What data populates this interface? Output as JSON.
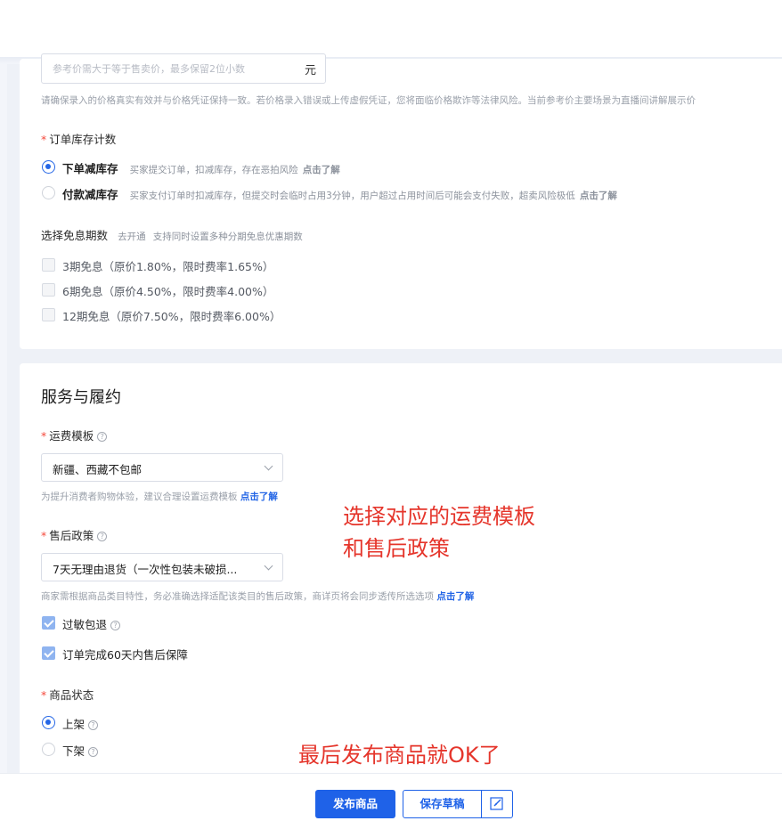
{
  "price": {
    "placeholder": "参考价需大于等于售卖价，最多保留2位小数",
    "unit": "元",
    "hint": "请确保录入的价格真实有效并与价格凭证保持一致。若价格录入错误或上传虚假凭证，您将面临价格欺诈等法律风险。当前参考价主要场景为直播间讲解展示价"
  },
  "stock": {
    "label": "订单库存计数",
    "options": [
      {
        "title": "下单减库存",
        "desc": "买家提交订单，扣减库存，存在恶拍风险",
        "link": "点击了解",
        "selected": true
      },
      {
        "title": "付款减库存",
        "desc": "买家支付订单时扣减库存，但提交时会临时占用3分钟，用户超过占用时间后可能会支付失败，超卖风险极低",
        "link": "点击了解",
        "selected": false
      }
    ]
  },
  "installment": {
    "label": "选择免息期数",
    "link": "去开通",
    "desc": "支持同时设置多种分期免息优惠期数",
    "options": [
      {
        "text": "3期免息（原价1.80%，限时费率1.65%）",
        "checked": false
      },
      {
        "text": "6期免息（原价4.50%，限时费率4.00%）",
        "checked": false
      },
      {
        "text": "12期免息（原价7.50%，限时费率6.00%）",
        "checked": false
      }
    ]
  },
  "service": {
    "title": "服务与履约",
    "shipping": {
      "label": "运费模板",
      "value": "新疆、西藏不包邮",
      "hint": "为提升消费者购物体验，建议合理设置运费模板",
      "link": "点击了解"
    },
    "aftersale": {
      "label": "售后政策",
      "value": "7天无理由退货（一次性包装未破损...",
      "hint": "商家需根据商品类目特性，务必准确选择适配该类目的售后政策，商详页将会同步透传所选选项",
      "link": "点击了解",
      "checks": [
        {
          "text": "过敏包退",
          "checked": true,
          "help": true
        },
        {
          "text": "订单完成60天内售后保障",
          "checked": true,
          "help": false
        }
      ]
    },
    "status": {
      "label": "商品状态",
      "options": [
        {
          "text": "上架",
          "selected": true
        },
        {
          "text": "下架",
          "selected": false
        }
      ]
    }
  },
  "annotations": {
    "line1": "选择对应的运费模板",
    "line2": "和售后政策",
    "line3": "最后发布商品就OK了"
  },
  "footer": {
    "publish_label": "发布商品",
    "draft_label": "保存草稿"
  },
  "colors": {
    "primary": "#1f62e8",
    "required": "#f5483b",
    "annotation": "#e5352b"
  },
  "help_icon_glyph": "?"
}
